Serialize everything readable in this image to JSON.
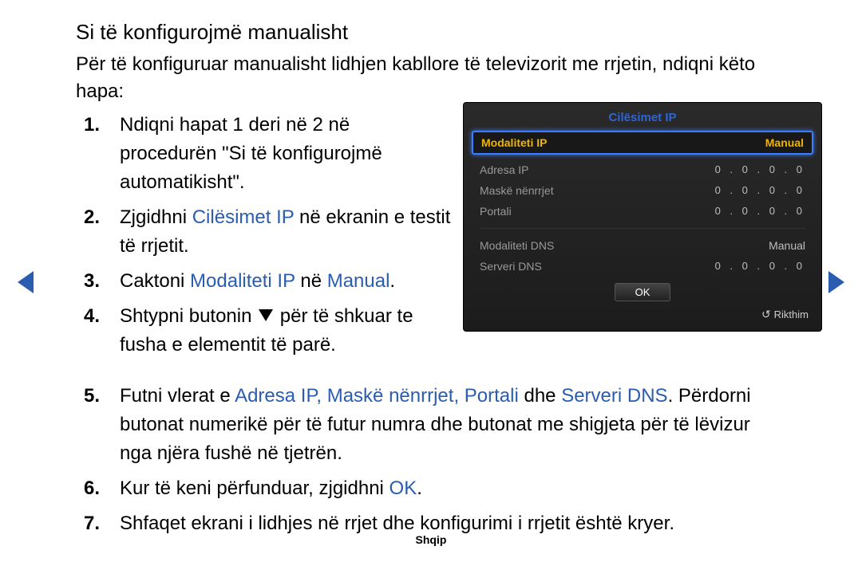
{
  "title": "Si të konfigurojmë manualisht",
  "intro": "Për të konfiguruar manualisht lidhjen kabllore të televizorit me rrjetin, ndiqni këto hapa:",
  "steps": {
    "s1": {
      "num": "1.",
      "text": "Ndiqni hapat 1 deri në 2 në procedurën \"Si të konfigurojmë automatikisht\"."
    },
    "s2": {
      "num": "2.",
      "a": "Zjgidhni ",
      "b": "Cilësimet IP",
      "c": " në ekranin e testit të rrjetit."
    },
    "s3": {
      "num": "3.",
      "a": "Caktoni ",
      "b": "Modaliteti IP",
      "c": " në ",
      "d": "Manual",
      "e": "."
    },
    "s4": {
      "num": "4.",
      "a": "Shtypni butonin ",
      "b": " për të shkuar te fusha e elementit të parë."
    },
    "s5": {
      "num": "5.",
      "a": "Futni vlerat e ",
      "b": "Adresa IP, Maskë nënrrjet, Portali",
      "c": " dhe ",
      "d": "Serveri DNS",
      "e": ". Përdorni butonat numerikë për të futur numra dhe butonat me shigjeta për të lëvizur nga njëra fushë në tjetrën."
    },
    "s6": {
      "num": "6.",
      "a": "Kur të keni përfunduar, zjgidhni ",
      "b": "OK",
      "c": "."
    },
    "s7": {
      "num": "7.",
      "text": "Shfaqet ekrani i lidhjes në rrjet dhe konfigurimi i rrjetit është kryer."
    }
  },
  "tv": {
    "title": "Cilësimet IP",
    "sel_label": "Modaliteti IP",
    "sel_value": "Manual",
    "rows": {
      "r1": {
        "label": "Adresa IP",
        "value": "0 . 0 . 0 . 0"
      },
      "r2": {
        "label": "Maskë nënrrjet",
        "value": "0 . 0 . 0 . 0"
      },
      "r3": {
        "label": "Portali",
        "value": "0 . 0 . 0 . 0"
      },
      "r4": {
        "label": "Modaliteti DNS",
        "value": "Manual"
      },
      "r5": {
        "label": "Serveri DNS",
        "value": "0 . 0 . 0 . 0"
      }
    },
    "ok": "OK",
    "return": "Rikthim"
  },
  "footer": "Shqip"
}
